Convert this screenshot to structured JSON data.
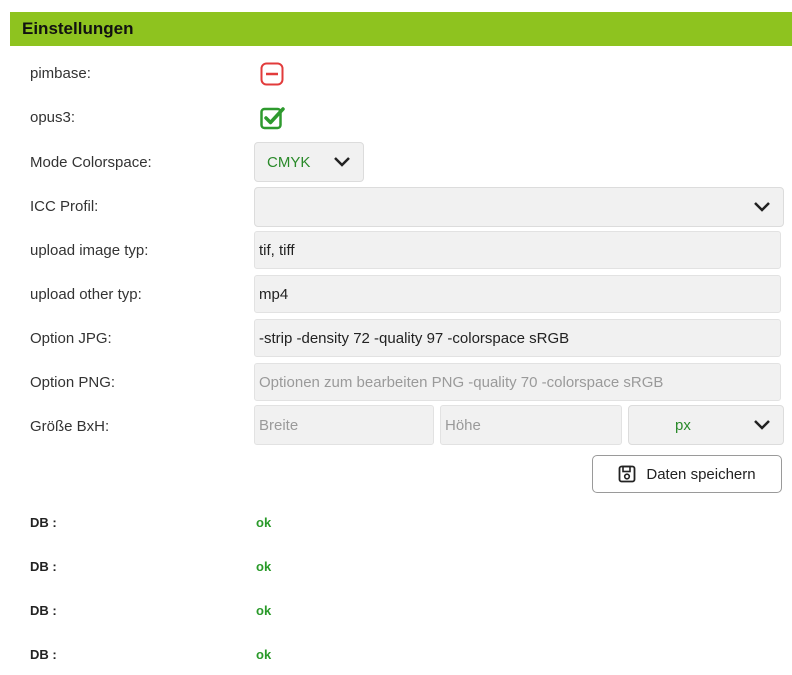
{
  "header": {
    "title": "Einstellungen"
  },
  "labels": {
    "pimbase": "pimbase:",
    "opus3": "opus3:",
    "mode_colorspace": "Mode Colorspace:",
    "icc_profil": "ICC Profil:",
    "upload_image_typ": "upload image typ:",
    "upload_other_typ": "upload other typ:",
    "option_jpg": "Option JPG:",
    "option_png": "Option PNG:",
    "groesse": "Größe BxH:"
  },
  "fields": {
    "pimbase_state": "disabled",
    "opus3_state": "checked",
    "mode_colorspace": "CMYK",
    "icc_profil": "",
    "upload_image_typ": "tif, tiff",
    "upload_other_typ": "mp4",
    "option_jpg": "-strip -density 72 -quality 97 -colorspace sRGB",
    "option_png_placeholder": "Optionen zum bearbeiten PNG -quality 70 -colorspace sRGB",
    "breite_placeholder": "Breite",
    "hoehe_placeholder": "Höhe",
    "unit": "px"
  },
  "buttons": {
    "save": "Daten speichern"
  },
  "db_status": [
    {
      "label": "DB :",
      "value": "ok"
    },
    {
      "label": "DB :",
      "value": "ok"
    },
    {
      "label": "DB :",
      "value": "ok"
    },
    {
      "label": "DB :",
      "value": "ok"
    }
  ],
  "colors": {
    "header_bg": "#8ec31f",
    "ok": "#2a9a2a",
    "minus_icon": "#e23b3b",
    "check_icon": "#2e9a2e"
  }
}
